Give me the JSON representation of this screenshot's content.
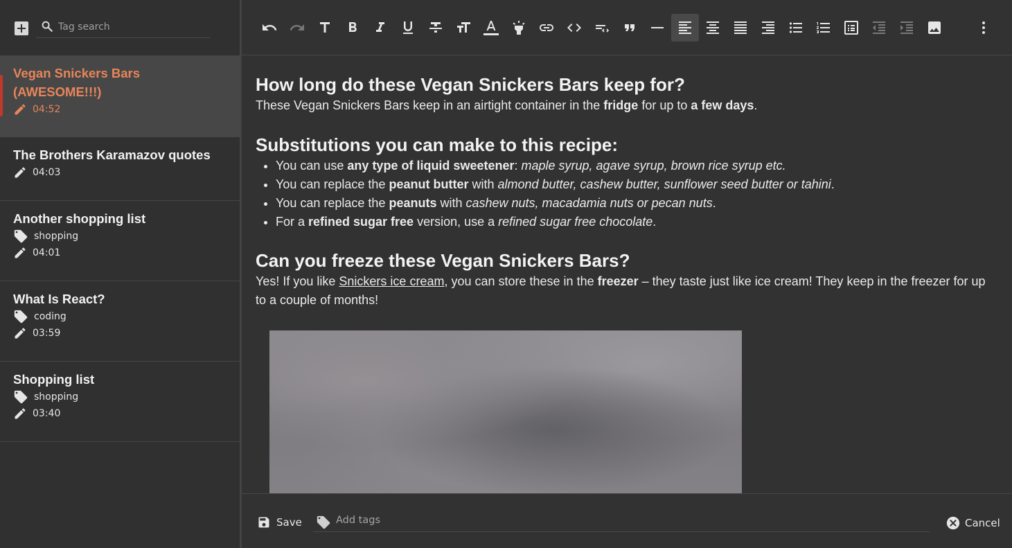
{
  "sidebar": {
    "add_icon": "add-box-icon",
    "search": {
      "placeholder": "Tag search",
      "icon": "search-icon"
    },
    "notes": [
      {
        "title": "Vegan Snickers Bars (AWESOME!!!)",
        "time": "04:52",
        "active": true
      },
      {
        "title": "The Brothers Karamazov quotes",
        "time": "04:03"
      },
      {
        "title": "Another shopping list",
        "tag": "shopping",
        "time": "04:01"
      },
      {
        "title": "What Is React?",
        "tag": "coding",
        "time": "03:59"
      },
      {
        "title": "Shopping list",
        "tag": "shopping",
        "time": "03:40"
      }
    ]
  },
  "toolbar": {
    "buttons": [
      "undo",
      "redo",
      "text-style",
      "bold",
      "italic",
      "underline",
      "strikethrough",
      "font-size",
      "font-color",
      "highlight",
      "link",
      "code",
      "code-block",
      "quote",
      "horizontal-rule",
      "align-left",
      "align-center",
      "align-justify",
      "align-right",
      "bulleted-list",
      "numbered-list",
      "checklist",
      "outdent",
      "indent",
      "insert-image",
      "more"
    ],
    "active": "align-left"
  },
  "content": {
    "h1": "How long do these Vegan Snickers Bars keep for?",
    "p1": {
      "a": "These Vegan Snickers Bars keep in an airtight container in the ",
      "b": "fridge",
      "c": " for up to ",
      "d": "a few days",
      "e": "."
    },
    "h2": "Substitutions you can make to this recipe:",
    "list": [
      {
        "a": "You can use ",
        "b": "any type of liquid sweetener",
        "c": ": ",
        "i": "maple syrup, agave syrup, brown rice syrup etc."
      },
      {
        "a": "You can replace the ",
        "b": "peanut butter",
        "c": " with ",
        "i": "almond butter, cashew butter, sunflower seed butter or tahini",
        "d": "."
      },
      {
        "a": "You can replace the ",
        "b": "peanuts",
        "c": " with ",
        "i": "cashew nuts, macadamia nuts or pecan nuts",
        "d": "."
      },
      {
        "a": "For a ",
        "b": "refined sugar free",
        "c": " version, use a ",
        "i": "refined sugar free chocolate",
        "d": "."
      }
    ],
    "h3": "Can you freeze these Vegan Snickers Bars?",
    "p2": {
      "a": "Yes! If you like ",
      "link": "Snickers ice cream",
      "b": ", you can store these in the ",
      "bold": "freezer",
      "c": " – they taste just like ice cream! They keep in the freezer for up to a couple of months!"
    }
  },
  "footer": {
    "save_label": "Save",
    "tags_placeholder": "Add tags",
    "cancel_label": "Cancel"
  },
  "colors": {
    "accent": "#e8855a",
    "active_marker": "#c0392b",
    "background": "#323232"
  }
}
